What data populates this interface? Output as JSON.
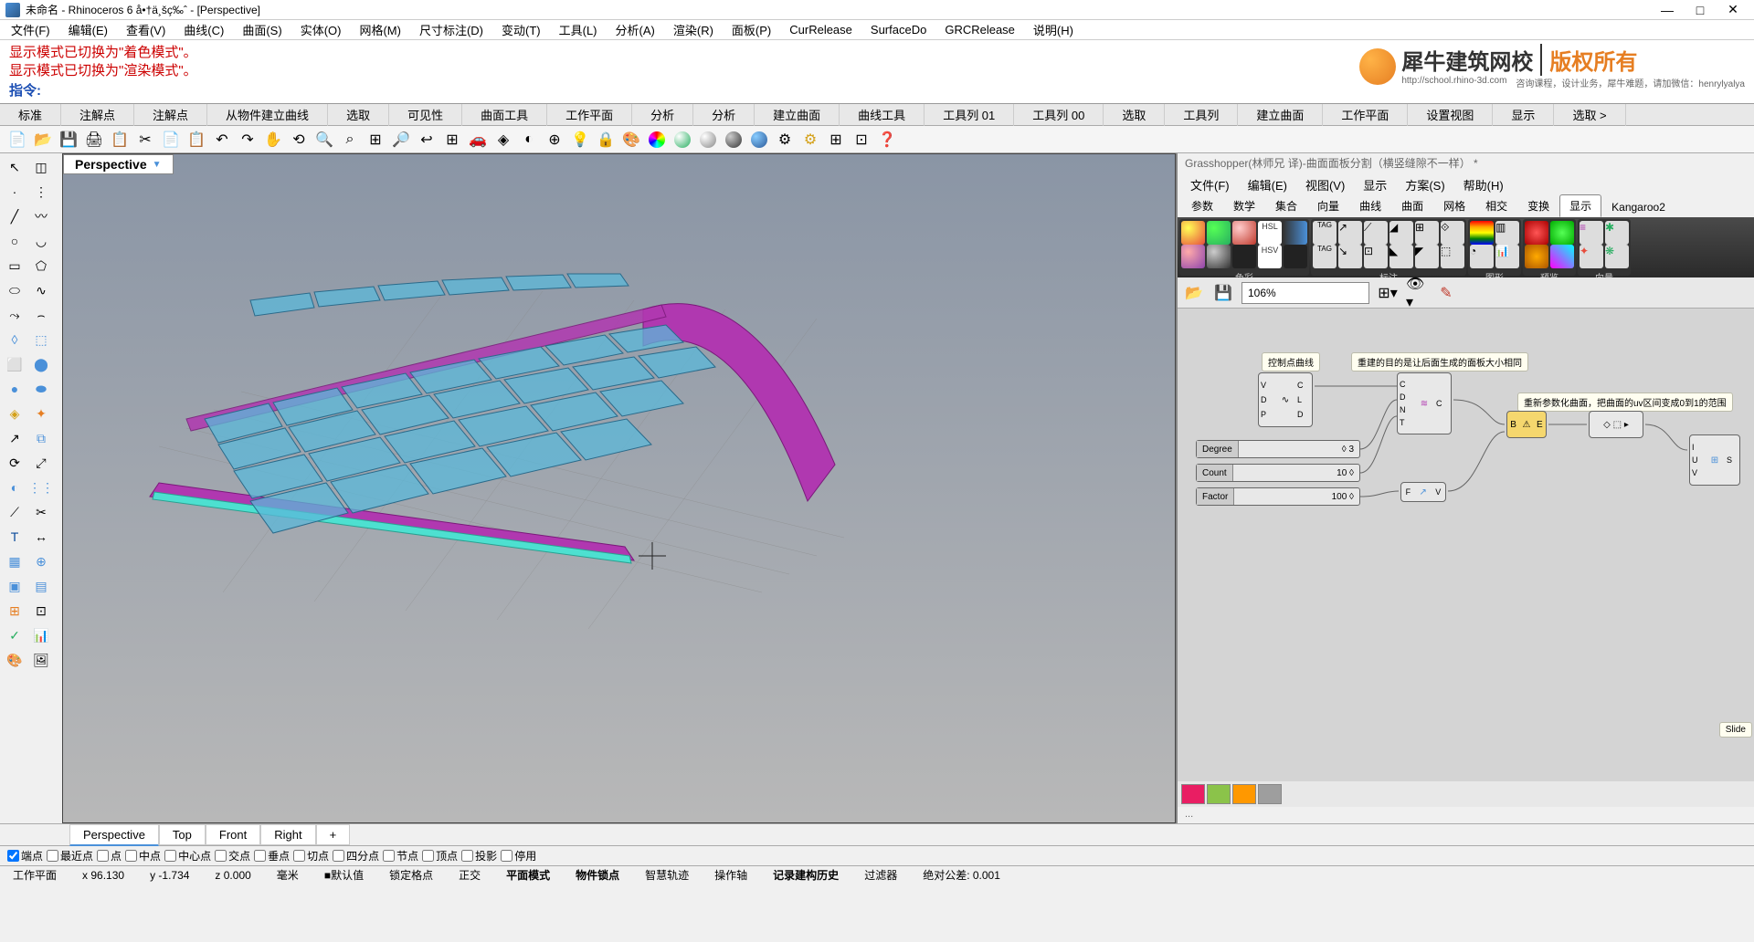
{
  "window": {
    "title": "未命名 - Rhinoceros 6 å•†ä¸šç‰ˆ - [Perspective]",
    "min": "—",
    "max": "□",
    "close": "✕"
  },
  "menus": [
    "文件(F)",
    "编辑(E)",
    "查看(V)",
    "曲线(C)",
    "曲面(S)",
    "实体(O)",
    "网格(M)",
    "尺寸标注(D)",
    "变动(T)",
    "工具(L)",
    "分析(A)",
    "渲染(R)",
    "面板(P)",
    "CurRelease",
    "SurfaceDo",
    "GRCRelease",
    "说明(H)"
  ],
  "console": {
    "line1": "显示模式已切换为\"着色模式\"。",
    "line2": "显示模式已切换为\"渲染模式\"。",
    "cmd": "指令:"
  },
  "logo": {
    "brand": "犀牛建筑网校",
    "rights": "版权所有",
    "sub1": "http://school.rhino-3d.com",
    "sub2": "咨询课程，设计业务，犀牛难题，请加微信：henrylyalya"
  },
  "tabs": [
    "标准",
    "注解点",
    "注解点",
    "从物件建立曲线",
    "选取",
    "可见性",
    "曲面工具",
    "工作平面",
    "分析",
    "分析",
    "建立曲面",
    "曲线工具",
    "工具列 01",
    "工具列 00",
    "选取",
    "工具列",
    "建立曲面",
    "工作平面",
    "设置视图",
    "显示",
    "选取 >"
  ],
  "viewport": {
    "title": "Perspective"
  },
  "view_tabs": [
    "Perspective",
    "Top",
    "Front",
    "Right",
    "+"
  ],
  "osnap": [
    "端点",
    "最近点",
    "点",
    "中点",
    "中心点",
    "交点",
    "垂点",
    "切点",
    "四分点",
    "节点",
    "顶点",
    "投影",
    "停用"
  ],
  "status": {
    "cplane": "工作平面",
    "x": "x 96.130",
    "y": "y -1.734",
    "z": "z 0.000",
    "unit": "毫米",
    "layer": "默认值",
    "items": [
      "锁定格点",
      "正交",
      "平面模式",
      "物件锁点",
      "智慧轨迹",
      "操作轴",
      "记录建构历史",
      "过滤器",
      "绝对公差: 0.001"
    ]
  },
  "gh": {
    "title": "Grasshopper(林师兄 译)-曲面面板分割（横竖缝隙不一样） *",
    "menus": [
      "文件(F)",
      "编辑(E)",
      "视图(V)",
      "显示",
      "方案(S)",
      "帮助(H)"
    ],
    "cat_tabs": [
      "参数",
      "数学",
      "集合",
      "向量",
      "曲线",
      "曲面",
      "网格",
      "相交",
      "变换",
      "显示",
      "Kangaroo2"
    ],
    "groups": [
      "色彩",
      "标注",
      "图形",
      "预览",
      "向量"
    ],
    "zoom": "106%",
    "notes": {
      "n1": "控制点曲线",
      "n2": "重建的目的是让后面生成的面板大小相同",
      "n3": "重新参数化曲面，把曲面的uv区间变成0到1的范围",
      "n4": "Slide"
    },
    "sliders": {
      "degree": {
        "label": "Degree",
        "val": "◊ 3"
      },
      "count": {
        "label": "Count",
        "val": "10 ◊"
      },
      "factor": {
        "label": "Factor",
        "val": "100 ◊"
      }
    },
    "status": "..."
  }
}
